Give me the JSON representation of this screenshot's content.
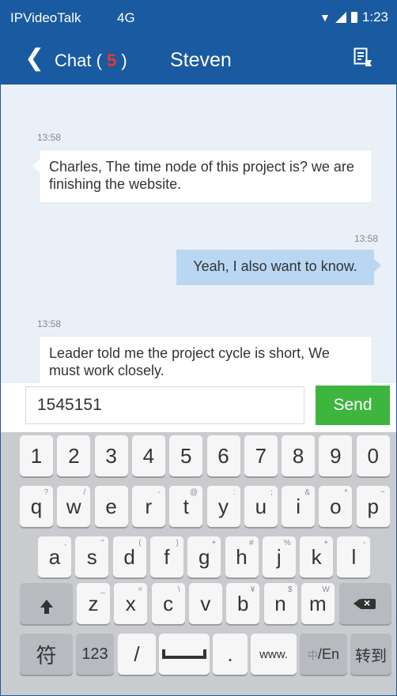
{
  "status_bar": {
    "app_name": "IPVideoTalk",
    "network": "4G",
    "time": "1:23"
  },
  "nav": {
    "back_label": "Chat (",
    "unread_count": "5",
    "back_label_close": ")",
    "contact_name": "Steven"
  },
  "messages": [
    {
      "time": "13:58",
      "text": "Charles, The time node of  this project is?  we are finishing the website."
    },
    {
      "time": "13:58",
      "text": "Yeah, I also want to know."
    },
    {
      "time": "13:58",
      "text": "Leader told me the project cycle is short, We must work closely."
    }
  ],
  "composer": {
    "value": "1545151",
    "send_label": "Send"
  },
  "keyboard": {
    "row1": [
      "1",
      "2",
      "3",
      "4",
      "5",
      "6",
      "7",
      "8",
      "9",
      "0"
    ],
    "row2": [
      "q",
      "w",
      "e",
      "r",
      "t",
      "y",
      "u",
      "i",
      "o",
      "p"
    ],
    "row2_hints": [
      "?",
      "/",
      "",
      "-",
      "@",
      ":",
      ";",
      "&",
      "*",
      "~"
    ],
    "row3": [
      "a",
      "s",
      "d",
      "f",
      "g",
      "h",
      "j",
      "k",
      "l"
    ],
    "row3_hints": [
      ",",
      "\"",
      "(",
      ")",
      "+",
      "#",
      "%",
      "+",
      "-"
    ],
    "row4": [
      "z",
      "x",
      "c",
      "v",
      "b",
      "n",
      "m"
    ],
    "row4_hints": [
      "_",
      "=",
      "\\",
      "",
      "¥",
      "$",
      "W"
    ],
    "bottom": {
      "symbols": "符",
      "num": "123",
      "slash": "/",
      "dot": ".",
      "www": "www.",
      "lang_cn": "中",
      "lang_en": "/En",
      "goto": "转到"
    }
  }
}
